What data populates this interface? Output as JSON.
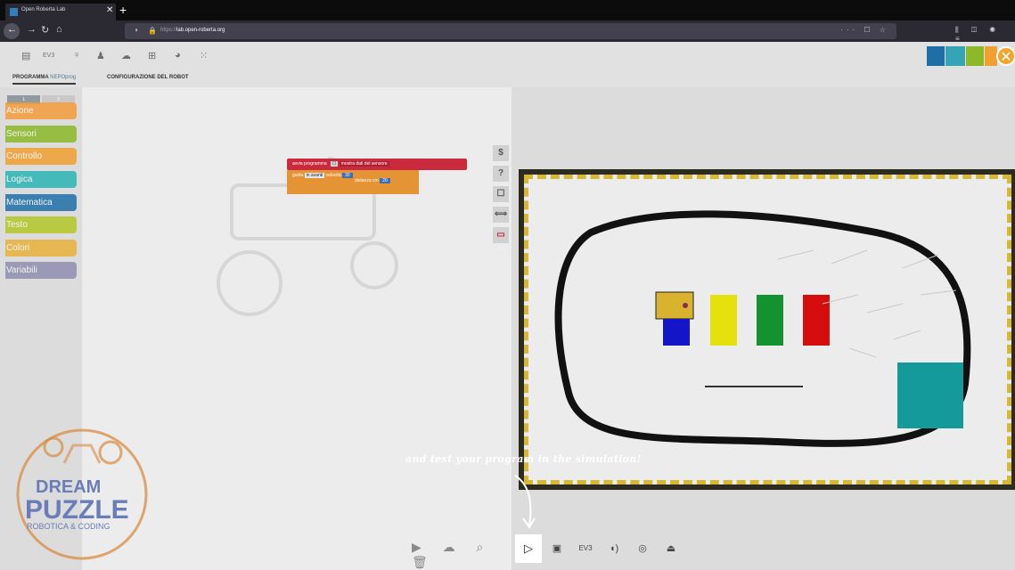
{
  "browser": {
    "tab_title": "Open Roberta Lab",
    "tab_close": "✕",
    "new_tab": "+",
    "url_scheme": "https://",
    "url_host": "lab.open-roberta.org",
    "url_icons": "··· ☐ ☆",
    "right_icons": "⫼ ◫ ◉ ≡"
  },
  "app": {
    "toolbar_icons": [
      "program-icon",
      "ev3-icon",
      "bulb-icon",
      "person-icon",
      "cloud-icon",
      "gallery-icon",
      "language-icon",
      "apps-icon"
    ],
    "tab_program": "PROGRAMMA",
    "tab_program_sub": "NEPOprog",
    "tab_config": "CONFIGURAZIONE DEL ROBOT",
    "level_tabs": [
      "1",
      "2"
    ],
    "categories": [
      {
        "label": "Azione",
        "color": "#f39c3a"
      },
      {
        "label": "Sensori",
        "color": "#8bb929"
      },
      {
        "label": "Controllo",
        "color": "#f0a031"
      },
      {
        "label": "Logica",
        "color": "#2bb5b5"
      },
      {
        "label": "Matematica",
        "color": "#1e6fa8"
      },
      {
        "label": "Testo",
        "color": "#b3c828"
      },
      {
        "label": "Colori",
        "color": "#e8b13a"
      },
      {
        "label": "Variabili",
        "color": "#8f8fb0"
      }
    ],
    "block": {
      "hat_label": "avvia programma",
      "hat_option": "mostra dati del sensore",
      "drive_label": "guida",
      "drive_direction": "in avanti",
      "speed_label": "velocità",
      "speed_value": "30",
      "distance_label": "distanza cm",
      "distance_value": "20"
    },
    "side_tools": [
      "$",
      "?",
      "☐",
      "⟺",
      "▭"
    ],
    "bottom_tools": "▶ ☁ ⌕ 🗑",
    "sim_buttons": [
      "▷",
      "▣",
      "EV3",
      "◖)",
      "◎",
      "⏏"
    ]
  },
  "annotation": "and test your program in the simulation!",
  "watermark": {
    "line1": "DREAM",
    "line2": "PUZZLE",
    "line3": "ROBOTICA & CODING"
  }
}
